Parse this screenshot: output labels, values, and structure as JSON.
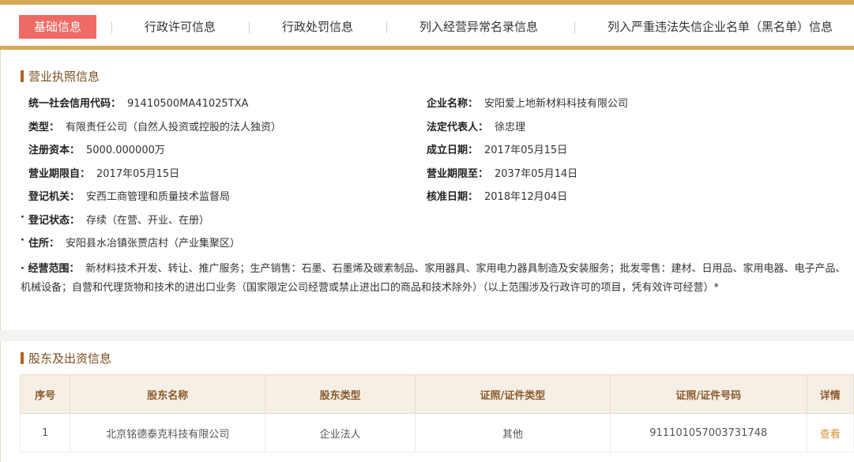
{
  "tabs": [
    {
      "label": "基础信息",
      "active": true
    },
    {
      "label": "行政许可信息"
    },
    {
      "label": "行政处罚信息"
    },
    {
      "label": "列入经营异常名录信息"
    },
    {
      "label": "列入严重违法失信企业名单（黑名单）信息"
    }
  ],
  "license_section": {
    "title": "营业执照信息",
    "credit_code": {
      "label": "统一社会信用代码：",
      "value": "91410500MA41025TXA"
    },
    "company_name": {
      "label": "企业名称：",
      "value": "安阳爱上地新材料科技有限公司"
    },
    "type": {
      "label": "类型：",
      "value": "有限责任公司（自然人投资或控股的法人独资）"
    },
    "legal_rep": {
      "label": "法定代表人：",
      "value": "徐忠理"
    },
    "capital": {
      "label": "注册资本：",
      "value": "5000.000000万"
    },
    "founded": {
      "label": "成立日期：",
      "value": "2017年05月15日"
    },
    "term_from": {
      "label": "营业期限自：",
      "value": "2017年05月15日"
    },
    "term_to": {
      "label": "营业期限至：",
      "value": "2037年05月14日"
    },
    "authority": {
      "label": "登记机关：",
      "value": "安西工商管理和质量技术监督局"
    },
    "approval_date": {
      "label": "核准日期：",
      "value": "2018年12月04日"
    },
    "status": {
      "label": "登记状态：",
      "value": "存续（在营、开业、在册）"
    },
    "address": {
      "label": "住所：",
      "value": "安阳县水冶镇张贾店村（产业集聚区）"
    },
    "scope": {
      "label": "经营范围：",
      "value": "新材料技术开发、转让、推广服务；生产销售：石墨、石墨烯及碳素制品、家用器具、家用电力器具制造及安装服务；批发零售：建材、日用品、家用电器、电子产品、机械设备；自营和代理货物和技术的进出口业务（国家限定公司经营或禁止进出口的商品和技术除外）（以上范围涉及行政许可的项目，凭有效许可经营）*"
    }
  },
  "shareholder_section": {
    "title": "股东及出资信息",
    "headers": [
      "序号",
      "股东名称",
      "股东类型",
      "证照/证件类型",
      "证照/证件号码",
      "详情"
    ],
    "rows": [
      {
        "no": "1",
        "name": "北京铭德泰克科技有限公司",
        "type": "企业法人",
        "cert_type": "其他",
        "cert_no": "911101057003731748",
        "detail": "查看"
      }
    ]
  },
  "colors": {
    "accent": "#d6a85a",
    "tab_active": "#ee6a65",
    "title_brown": "#7a4e1e",
    "link": "#d2933a"
  }
}
